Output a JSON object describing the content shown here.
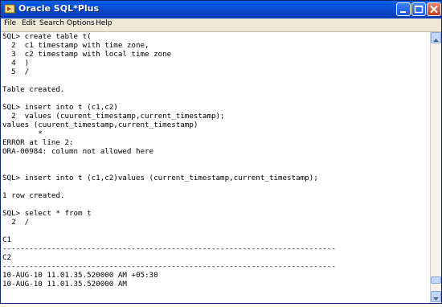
{
  "window": {
    "title": "Oracle SQL*Plus"
  },
  "menu": [
    "File",
    "Edit",
    "Search",
    "Options",
    "Help"
  ],
  "console_lines": [
    "SQL> create table t(",
    "  2  c1 timestamp with time zone,",
    "  3  c2 timestamp with local time zone",
    "  4  )",
    "  5  /",
    "",
    "Table created.",
    "",
    "SQL> insert into t (c1,c2)",
    "  2  values (cuurent_timestamp,current_timestamp);",
    "values (cuurent_timestamp,current_timestamp)",
    "        *",
    "ERROR at line 2:",
    "ORA-00984: column not allowed here",
    "",
    "",
    "SQL> insert into t (c1,c2)values (current_timestamp,current_timestamp);",
    "",
    "1 row created.",
    "",
    "SQL> select * from t",
    "  2  /",
    "",
    "C1",
    "---------------------------------------------------------------------------",
    "C2",
    "---------------------------------------------------------------------------",
    "10-AUG-10 11.01.35.520000 AM +05:30",
    "10-AUG-10 11.01.35.520000 AM"
  ],
  "colors": {
    "title_bar": "#0a4ad0",
    "console_bg": "#ffffff",
    "text": "#000000"
  },
  "icons": [
    "sqlplus-app-icon",
    "minimize-icon",
    "maximize-icon",
    "close-icon",
    "scroll-up-icon",
    "scroll-down-icon"
  ]
}
